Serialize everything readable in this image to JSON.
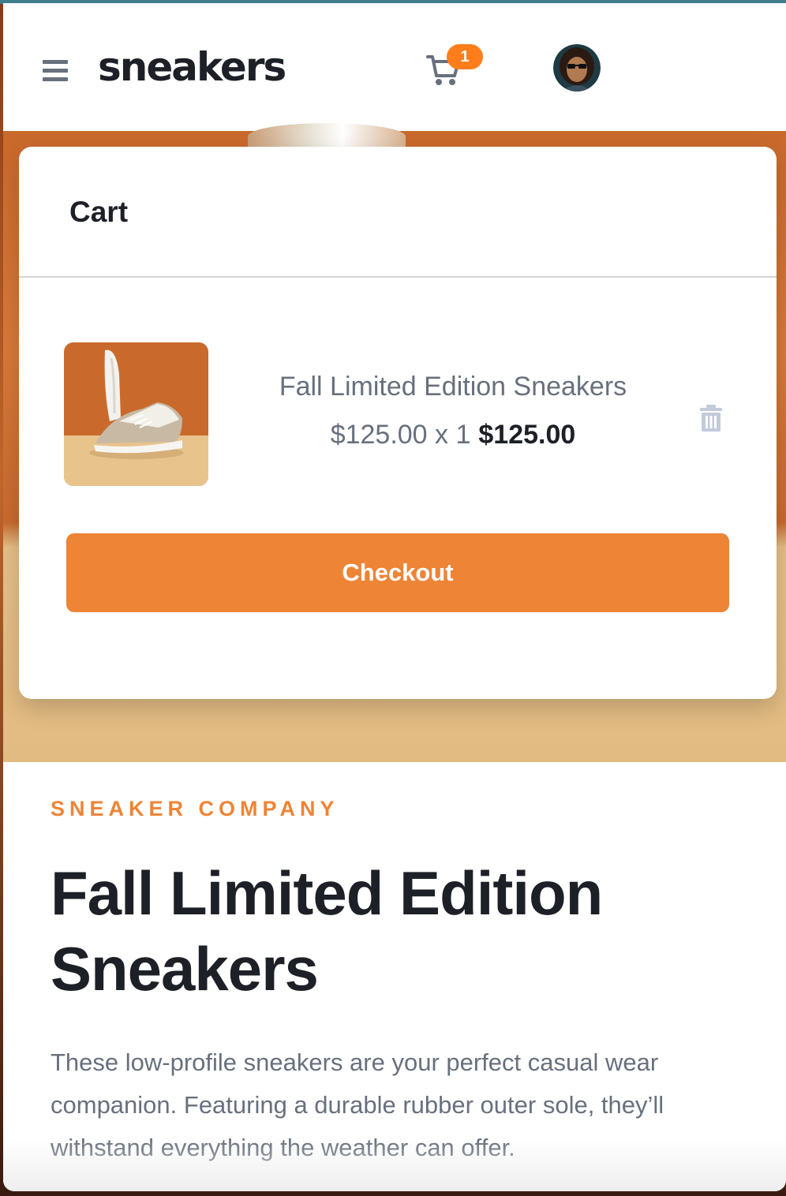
{
  "header": {
    "logo": "sneakers",
    "cart_count": "1",
    "menu_icon": "hamburger-menu-icon",
    "cart_icon": "cart-icon",
    "avatar_icon": "user-avatar"
  },
  "cart": {
    "title": "Cart",
    "item": {
      "name": "Fall Limited Edition Sneakers",
      "unit_price_quantity": "$125.00 x 1",
      "total": "$125.00",
      "thumbnail_icon": "product-thumbnail",
      "delete_icon": "trash-icon"
    },
    "checkout_label": "Checkout"
  },
  "product": {
    "company": "SNEAKER COMPANY",
    "title": "Fall Limited Edition Sneakers",
    "description": "These low-profile sneakers are your perfect casual wear companion. Featuring a durable rubber outer sole, they’ll withstand everything the weather can offer."
  },
  "colors": {
    "accent": "#ee8436",
    "dark": "#1d2026",
    "muted": "#68707d"
  }
}
